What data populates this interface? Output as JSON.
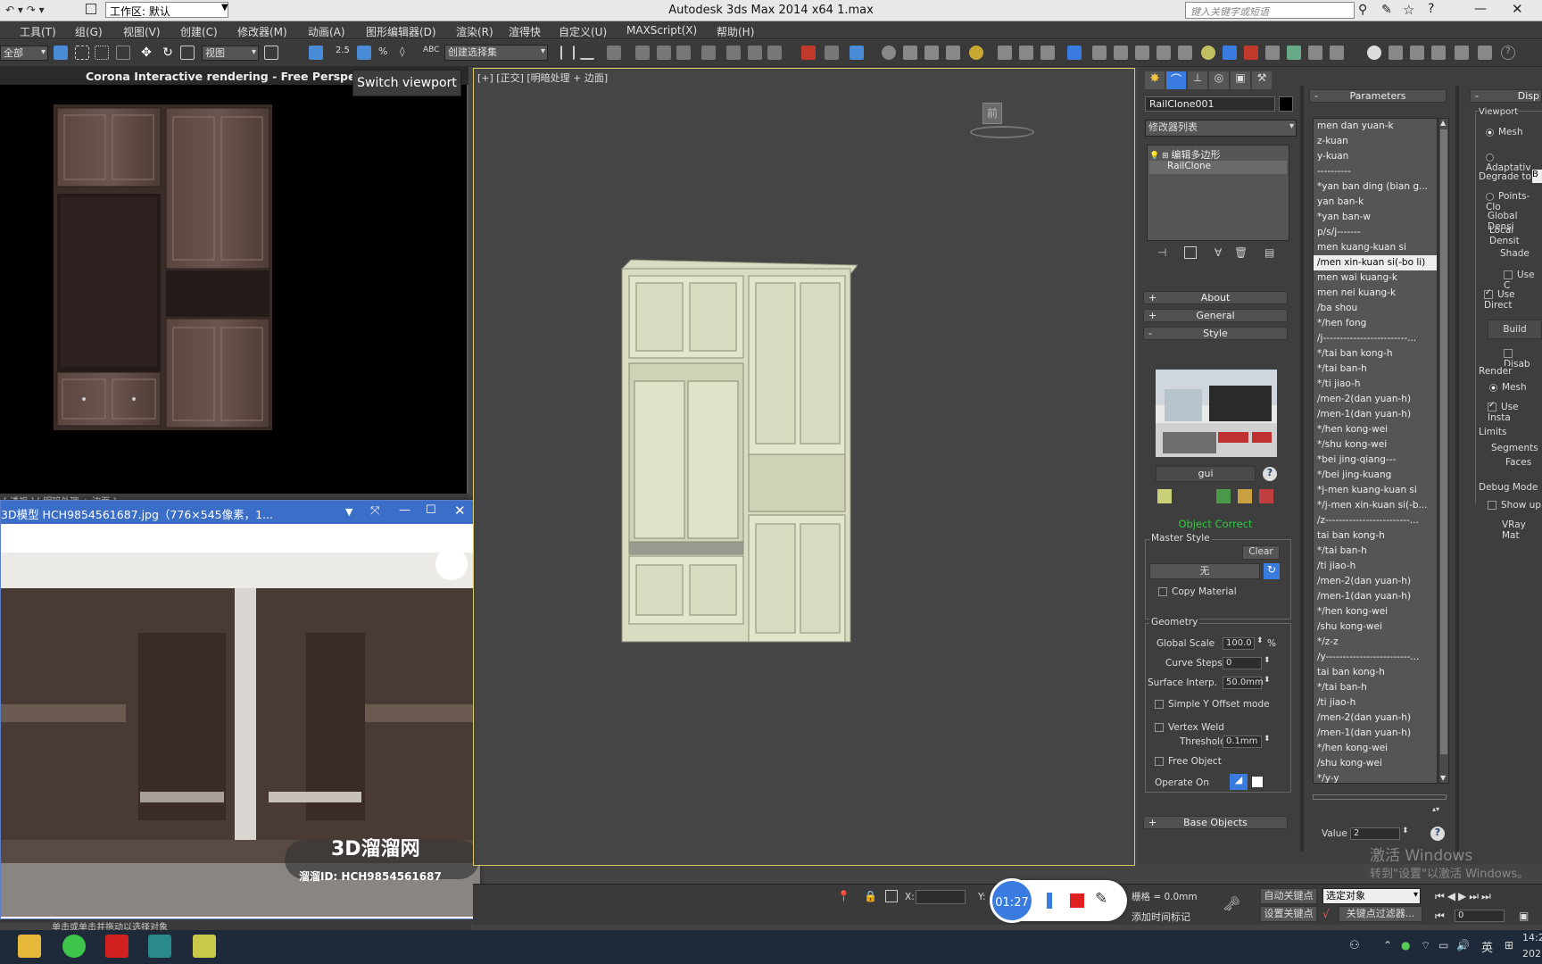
{
  "app": {
    "title": "Autodesk 3ds Max  2014 x64      1.max",
    "workspace": "工作区: 默认",
    "search_placeholder": "键入关键字或短语"
  },
  "menu": [
    "工具(T)",
    "组(G)",
    "视图(V)",
    "创建(C)",
    "修改器(M)",
    "动画(A)",
    "图形编辑器(D)",
    "渲染(R)",
    "渲得快",
    "自定义(U)",
    "MAXScript(X)",
    "帮助(H)"
  ],
  "toolbar": {
    "selection_filter": "全部",
    "ref_coord": "视图",
    "named_selection": "创建选择集"
  },
  "corona": {
    "header": "Corona Interactive rendering - Free Perspective",
    "tooltip": "Switch viewport",
    "sub_label": "[ 透视 ] [ 明暗处理 + 边面 ]"
  },
  "imageviewer": {
    "title": "3D模型 HCH9854561687.jpg（776×545像素，1...",
    "watermark": "3D溜溜网",
    "id_text": "溜溜ID:  HCH9854561687"
  },
  "viewport": {
    "label": "[+] [正交] [明暗处理 + 边面]",
    "cube_label": "前"
  },
  "modify": {
    "object_name": "RailClone001",
    "modifier_list": "修改器列表",
    "stack": [
      "编辑多边形",
      "RailClone"
    ],
    "rollouts": {
      "about": "About",
      "general": "General",
      "style": "Style",
      "base_objects": "Base Objects"
    },
    "style_name": "gui",
    "object_status": "Object Correct",
    "master_style": {
      "title": "Master Style",
      "clear": "Clear",
      "value": "无",
      "copy_material": "Copy Material"
    },
    "geometry": {
      "title": "Geometry",
      "global_scale_label": "Global Scale",
      "global_scale": "100.0",
      "pct": "%",
      "curve_steps_label": "Curve Steps",
      "curve_steps": "0",
      "surface_interp_label": "Surface Interp.",
      "surface_interp": "50.0mm",
      "simple_y": "Simple Y Offset mode",
      "vertex_weld": "Vertex Weld",
      "threshold_label": "Threshold",
      "threshold": "0.1mm",
      "free_object": "Free Object",
      "operate_on": "Operate On"
    }
  },
  "parameters": {
    "title": "Parameters",
    "items": [
      "men dan yuan-k",
      "z-kuan",
      "y-kuan",
      "----------",
      "*yan ban ding (bian g...",
      "yan ban-k",
      "*yan ban-w",
      "p/s/j-------",
      "men kuang-kuan si",
      "/men xin-kuan si(-bo li)",
      "men wai kuang-k",
      "men nei kuang-k",
      "/ba shou",
      "*/hen fong",
      "/j-------------------------...",
      "*/tai ban kong-h",
      "*/tai ban-h",
      "*/ti jiao-h",
      "/men-2(dan yuan-h)",
      "/men-1(dan yuan-h)",
      "*/hen kong-wei",
      "*/shu kong-wei",
      "*bei jing-qiang---",
      "*/bei jing-kuang",
      "*j-men kuang-kuan si",
      "*/j-men xin-kuan si(-b...",
      "/z-------------------------...",
      "tai ban kong-h",
      "*/tai ban-h",
      "/ti jiao-h",
      "/men-2(dan yuan-h)",
      "/men-1(dan yuan-h)",
      "*/hen kong-wei",
      "/shu kong-wei",
      "*/z-z",
      "/y-------------------------...",
      "tai ban kong-h",
      "*/tai ban-h",
      "/ti jiao-h",
      "/men-2(dan yuan-h)",
      "/men-1(dan yuan-h)",
      "*/hen kong-wei",
      "/shu kong-wei",
      "*/y-y"
    ],
    "selected_index": 9,
    "value_label": "Value",
    "value": "2"
  },
  "display": {
    "title": "Disp",
    "viewport_group": "Viewport",
    "mesh": "Mesh",
    "adaptive": "Adaptativ",
    "degrade_to": "Degrade to",
    "degrade_val": "B",
    "points_cloud": "Points-Clo",
    "global_density": "Global Densi",
    "local_density": "Local Densit",
    "shade": "Shade",
    "use_c": "Use C",
    "use_direct": "Use Direct",
    "build": "Build",
    "disable": "Disab",
    "render_group": "Render",
    "render_mesh": "Mesh",
    "use_instance": "Use Insta",
    "limits_group": "Limits",
    "segments": "Segments",
    "faces": "Faces",
    "debug_group": "Debug Mode",
    "show_up": "Show up",
    "vray_mat": "VRay Mat"
  },
  "status": {
    "x_label": "X:",
    "y_label": "Y:",
    "grid": "栅格 = 0.0mm",
    "add_time_tag": "添加时间标记",
    "auto_key": "自动关键点",
    "set_key": "设置关键点",
    "selected_object": "选定对象",
    "key_filter": "关键点过滤器...",
    "frame": "0",
    "prompt": "单击或单击并拖动以选择对象",
    "activate1": "激活 Windows",
    "activate2": "转到\"设置\"以激活 Windows。"
  },
  "recorder": {
    "time": "01:27"
  },
  "taskbar": {
    "ime": "英",
    "clock1": "14:2",
    "clock2": "202"
  }
}
